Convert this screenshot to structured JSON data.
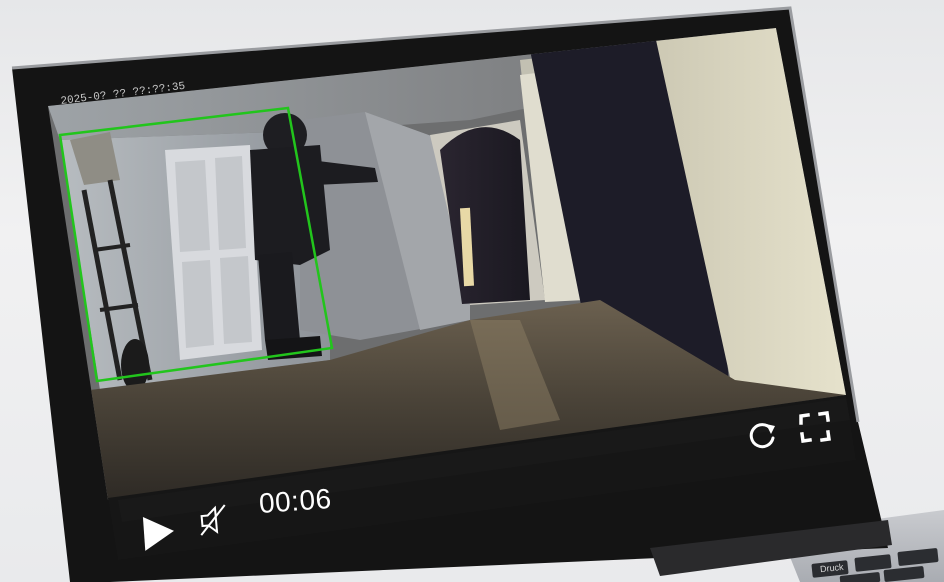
{
  "video": {
    "timestamp_overlay": "2025-0? ?? ??:??:35",
    "time": "00:06",
    "muted": true,
    "playing": false
  },
  "controls": {
    "play_icon": "play-icon",
    "mute_icon": "speaker-muted-icon",
    "replay_icon": "replay-icon",
    "fullscreen_icon": "fullscreen-icon"
  },
  "keyboard": {
    "visible_key_label": "Druck"
  },
  "colors": {
    "bezel": "#141414",
    "detection_box": "#22c51c",
    "control_bar": "#161616",
    "controls_fg": "#ffffff"
  }
}
